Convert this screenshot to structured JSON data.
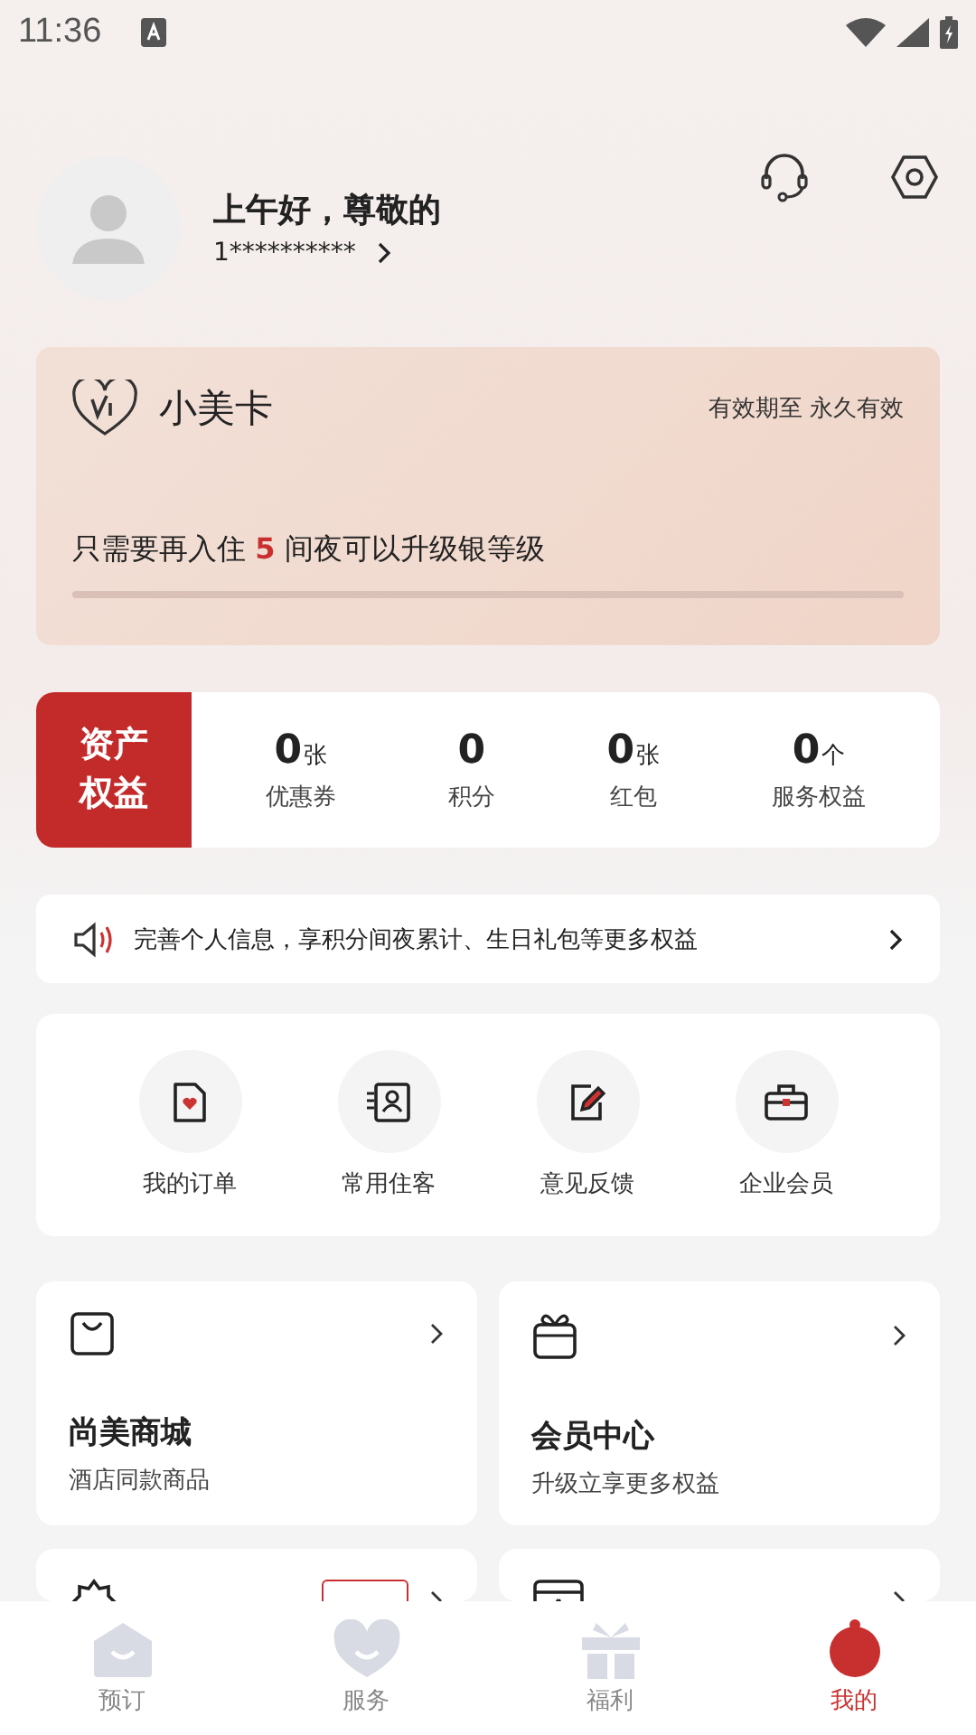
{
  "status_bar": {
    "time": "11:36"
  },
  "profile": {
    "greeting": "上午好，尊敬的",
    "account": "1**********"
  },
  "member_card": {
    "name": "小美卡",
    "validity": "有效期至 永久有效",
    "upgrade_text": "只需要再入住 **5** 间夜可以升级银等级",
    "level": 0
  },
  "assets": {
    "title": "资产权益",
    "items": [
      {
        "value": "0",
        "unit": "张",
        "label": "优惠券"
      },
      {
        "value": "0",
        "label": "积分"
      },
      {
        "value": "0",
        "unit": "张",
        "label": "红包"
      },
      {
        "value": "0",
        "unit": "个",
        "label": "服务权益"
      }
    ]
  },
  "notice": {
    "text": "完善个人信息，享积分间夜累计、生日礼包等更多权益"
  },
  "quick_actions": [
    {
      "kind": "order",
      "label": "我的订单"
    },
    {
      "kind": "guest",
      "label": "常用住客"
    },
    {
      "kind": "feedback",
      "label": "意见反馈"
    },
    {
      "kind": "enterprise",
      "label": "企业会员"
    }
  ],
  "feature_cards": [
    {
      "kind": "bag",
      "title": "尚美商城",
      "subtitle": "酒店同款商品",
      "tagged": false
    },
    {
      "kind": "gift",
      "title": "会员中心",
      "subtitle": "升级立享更多权益",
      "tagged": false
    },
    {
      "kind": "badge",
      "tagged": true
    },
    {
      "kind": "calendar",
      "tagged": false
    }
  ],
  "tabs": [
    {
      "kind": "home",
      "label": "预订",
      "selected": false
    },
    {
      "kind": "heart",
      "label": "服务",
      "selected": false
    },
    {
      "kind": "gift",
      "label": "福利",
      "selected": false
    },
    {
      "kind": "user",
      "label": "我的",
      "selected": true
    }
  ]
}
